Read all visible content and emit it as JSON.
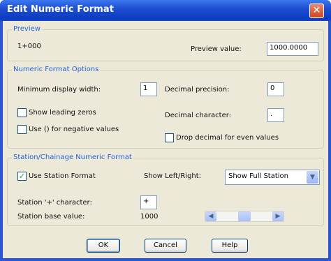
{
  "window": {
    "title": "Edit Numeric Format",
    "close_glyph": "✕"
  },
  "preview": {
    "legend": "Preview",
    "sample_text": "1+000",
    "value_label": "Preview value:",
    "value": "1000.0000"
  },
  "numeric_options": {
    "legend": "Numeric Format Options",
    "min_width_label": "Minimum display width:",
    "min_width_value": "1",
    "decimal_precision_label": "Decimal precision:",
    "decimal_precision_value": "0",
    "show_leading_zeros_label": "Show leading zeros",
    "show_leading_zeros_checked": false,
    "use_parens_label": "Use () for negative values",
    "use_parens_checked": false,
    "decimal_char_label": "Decimal character:",
    "decimal_char_value": ".",
    "drop_decimal_label": "Drop decimal for even values",
    "drop_decimal_checked": false
  },
  "station": {
    "legend": "Station/Chainage Numeric Format",
    "use_station_label": "Use Station Format",
    "use_station_checked": true,
    "check_glyph": "✓",
    "left_right_label": "Show Left/Right:",
    "left_right_value": "Show Full Station",
    "station_char_label": "Station '+' character:",
    "station_char_value": "+",
    "base_value_label": "Station base value:",
    "base_value": "1000",
    "scroll_left_glyph": "◀",
    "scroll_right_glyph": "▶",
    "dropdown_glyph": "▼",
    "scroll_position": 0.5
  },
  "buttons": {
    "ok": "OK",
    "cancel": "Cancel",
    "help": "Help"
  }
}
